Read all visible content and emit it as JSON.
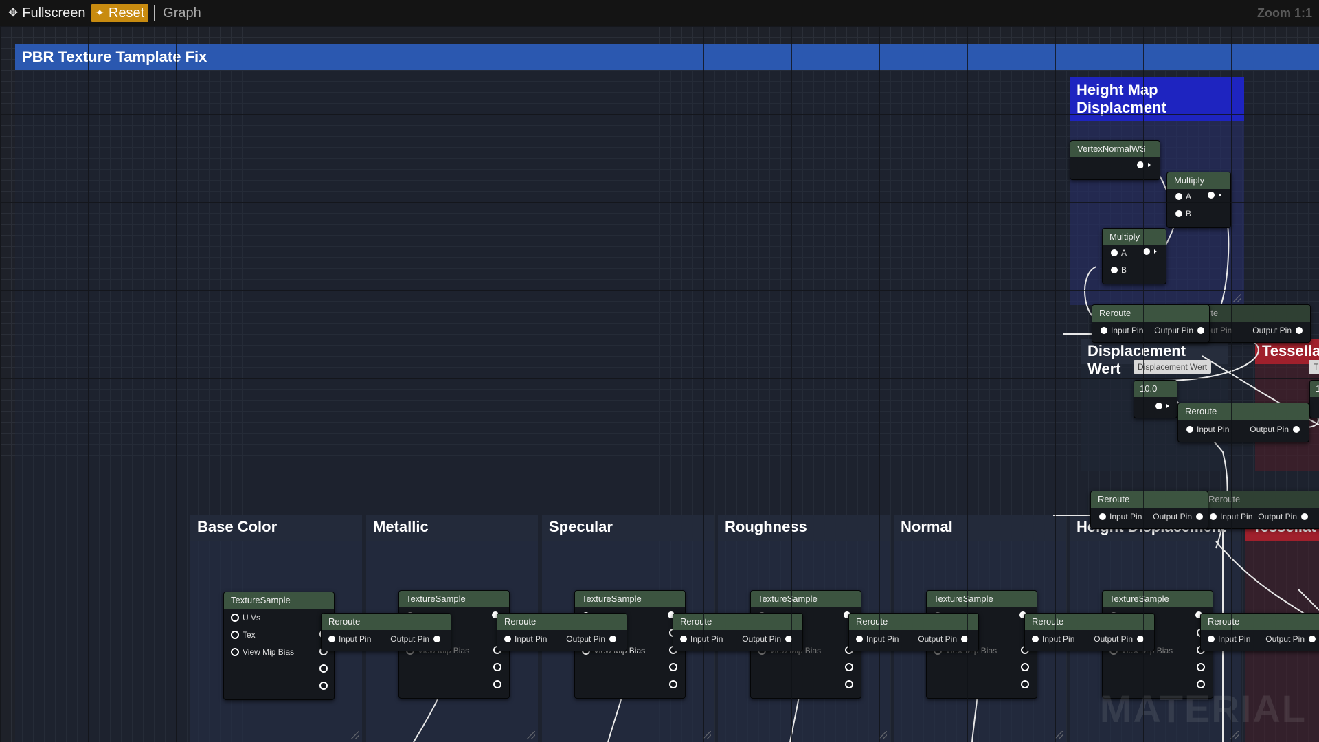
{
  "toolbar": {
    "fullscreen_label": "Fullscreen",
    "fullscreen_icon": "expand-icon",
    "reset_label": "Reset",
    "reset_icon": "sparkle-icon",
    "graph_label": "Graph",
    "zoom_label": "Zoom 1:1"
  },
  "groups": {
    "main_title": "PBR Texture Tamplate Fix",
    "height_map": "Height Map Displacment",
    "displacement_wert": "Displacement Wert",
    "tessellation_top": "Tessella",
    "base_color": "Base Color",
    "metallic": "Metallic",
    "specular": "Specular",
    "roughness": "Roughness",
    "normal": "Normal",
    "height_displacement": "Height Displacement",
    "tessellation_bottom": "Tessellat"
  },
  "nodes": {
    "vertex_normal": "VertexNormalWS",
    "multiply": "Multiply",
    "reroute": "Reroute",
    "texture_sample": "TextureSample",
    "param_label": "Displacement Wert",
    "param_value": "10.0",
    "tess_param_label": "T",
    "tess_param_value": "1"
  },
  "pins": {
    "a": "A",
    "b": "B",
    "input": "Input Pin",
    "output": "Output Pin",
    "uvs": "U Vs",
    "tex": "Tex",
    "mip": "View Mip Bias"
  },
  "watermark": "MATERIAL",
  "colors": {
    "toolbar_bg": "#141414",
    "reset_accent": "#c88b10",
    "main_comment": "#2b58b0",
    "height_map_comment": "#1e24c0",
    "tessellation_comment": "#a0202c",
    "node_header": "#3c5440"
  }
}
